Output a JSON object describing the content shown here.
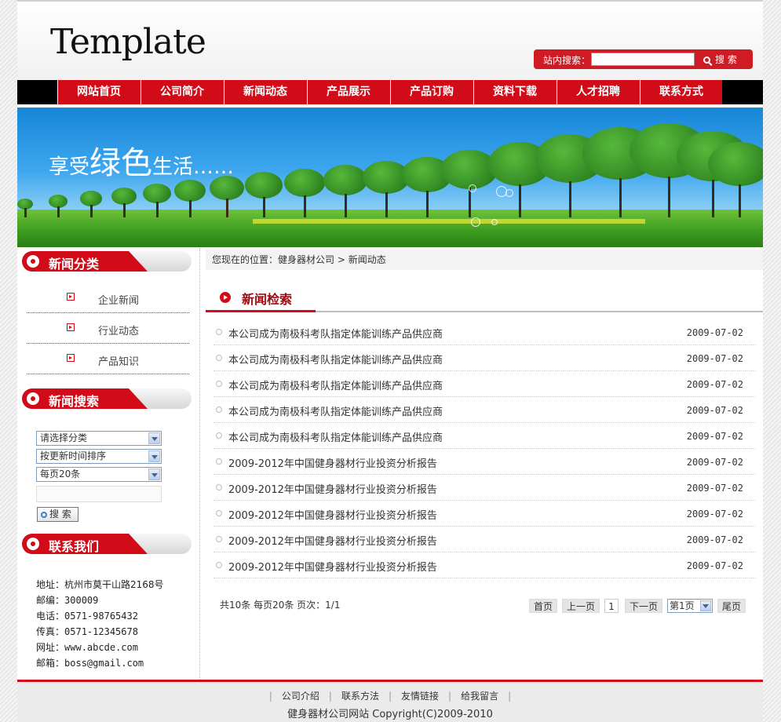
{
  "header": {
    "logo": "Template",
    "search_label": "站内搜索：",
    "search_value": "",
    "search_button": "搜 索"
  },
  "nav": [
    "网站首页",
    "公司简介",
    "新闻动态",
    "产品展示",
    "产品订购",
    "资料下载",
    "人才招聘",
    "联系方式"
  ],
  "banner": {
    "slogan_prefix": "享受",
    "slogan_big": "绿色",
    "slogan_suffix": "生活……"
  },
  "sidebar": {
    "cat_title": "新闻分类",
    "categories": [
      "企业新闻",
      "行业动态",
      "产品知识"
    ],
    "search_title": "新闻搜索",
    "select_category": "请选择分类",
    "select_sort": "按更新时间排序",
    "select_per_page": "每页20条",
    "keyword_value": "",
    "search_button": "搜 索",
    "contact_title": "联系我们",
    "contact": [
      {
        "k": "地址：",
        "v": "杭州市莫干山路2168号"
      },
      {
        "k": "邮编：",
        "v": "300009"
      },
      {
        "k": "电话：",
        "v": "0571-98765432"
      },
      {
        "k": "传真：",
        "v": "0571-12345678"
      },
      {
        "k": "网址：",
        "v": "www.abcde.com"
      },
      {
        "k": "邮箱：",
        "v": "boss@gmail.com"
      }
    ]
  },
  "breadcrumb": {
    "prefix": "您现在的位置：",
    "home": "健身器材公司",
    "sep": " > ",
    "current": "新闻动态"
  },
  "main": {
    "title": "新闻检索",
    "items": [
      {
        "title": "本公司成为南极科考队指定体能训练产品供应商",
        "date": "2009-07-02"
      },
      {
        "title": "本公司成为南极科考队指定体能训练产品供应商",
        "date": "2009-07-02"
      },
      {
        "title": "本公司成为南极科考队指定体能训练产品供应商",
        "date": "2009-07-02"
      },
      {
        "title": "本公司成为南极科考队指定体能训练产品供应商",
        "date": "2009-07-02"
      },
      {
        "title": "本公司成为南极科考队指定体能训练产品供应商",
        "date": "2009-07-02"
      },
      {
        "title": "2009-2012年中国健身器材行业投资分析报告",
        "date": "2009-07-02"
      },
      {
        "title": "2009-2012年中国健身器材行业投资分析报告",
        "date": "2009-07-02"
      },
      {
        "title": "2009-2012年中国健身器材行业投资分析报告",
        "date": "2009-07-02"
      },
      {
        "title": "2009-2012年中国健身器材行业投资分析报告",
        "date": "2009-07-02"
      },
      {
        "title": "2009-2012年中国健身器材行业投资分析报告",
        "date": "2009-07-02"
      }
    ],
    "pager": {
      "info": "共10条  每页20条  页次：1/1",
      "first": "首页",
      "prev": "上一页",
      "current": "1",
      "next": "下一页",
      "page_select": "第1页",
      "last": "尾页"
    }
  },
  "footer": {
    "links": [
      "公司介绍",
      "联系方法",
      "友情链接",
      "给我留言"
    ],
    "copyright": "健身器材公司网站 Copyright(C)2009-2010"
  },
  "colors": {
    "brand_red": "#d10b17",
    "nav_black": "#000000"
  }
}
